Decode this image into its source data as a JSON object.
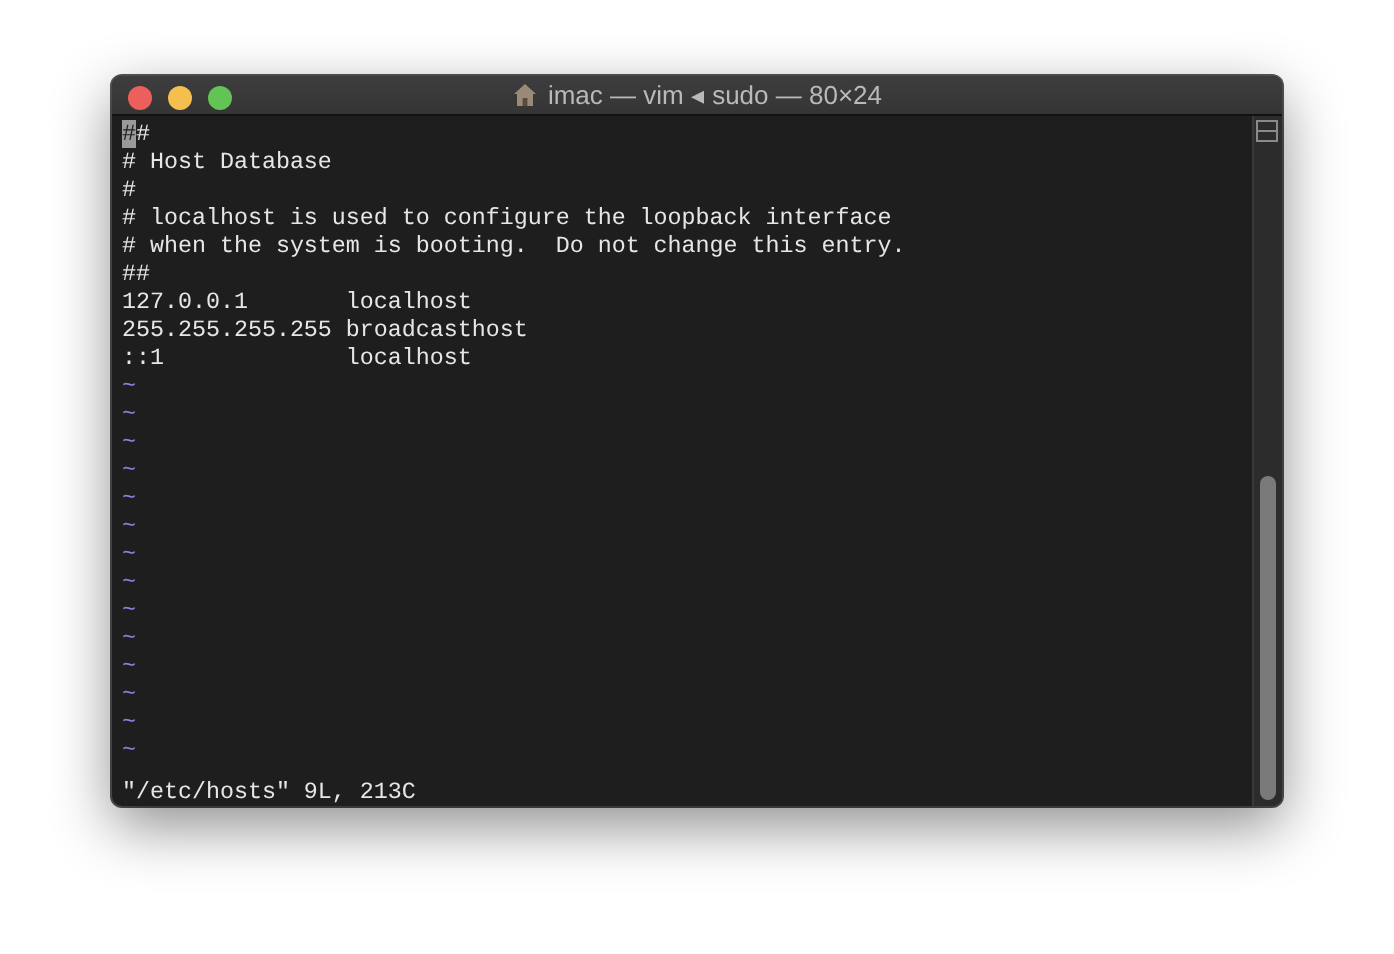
{
  "window": {
    "title": "imac — vim ◂ sudo — 80×24"
  },
  "buffer": [
    {
      "text": "##",
      "cursor": true
    },
    {
      "text": "# Host Database",
      "cursor": false
    },
    {
      "text": "#",
      "cursor": false
    },
    {
      "text": "# localhost is used to configure the loopback interface",
      "cursor": false
    },
    {
      "text": "# when the system is booting.  Do not change this entry.",
      "cursor": false
    },
    {
      "text": "##",
      "cursor": false
    },
    {
      "text": "127.0.0.1       localhost",
      "cursor": false
    },
    {
      "text": "255.255.255.255 broadcasthost",
      "cursor": false
    },
    {
      "text": "::1             localhost",
      "cursor": false
    }
  ],
  "empty_lines": [
    "~",
    "~",
    "~",
    "~",
    "~",
    "~",
    "~",
    "~",
    "~",
    "~",
    "~",
    "~",
    "~",
    "~"
  ],
  "status_line": "\"/etc/hosts\" 9L, 213C"
}
